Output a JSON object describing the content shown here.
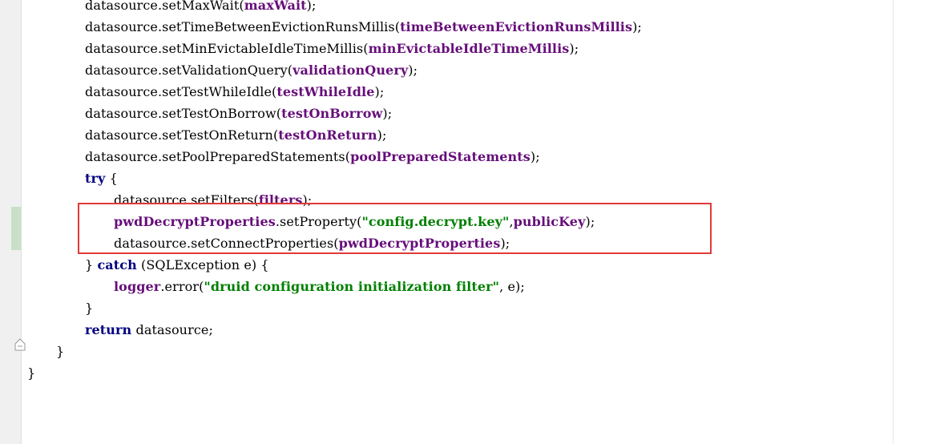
{
  "editor": {
    "lines": [
      {
        "indent": 2,
        "tokens": [
          {
            "t": "datasource",
            "c": "plain"
          },
          {
            "t": ".",
            "c": "plain"
          },
          {
            "t": "setMaxWait",
            "c": "mth"
          },
          {
            "t": "(",
            "c": "plain"
          },
          {
            "t": "maxWait",
            "c": "fld"
          },
          {
            "t": ");",
            "c": "plain"
          }
        ]
      },
      {
        "indent": 2,
        "tokens": [
          {
            "t": "datasource",
            "c": "plain"
          },
          {
            "t": ".",
            "c": "plain"
          },
          {
            "t": "setTimeBetweenEvictionRunsMillis",
            "c": "mth"
          },
          {
            "t": "(",
            "c": "plain"
          },
          {
            "t": "timeBetweenEvictionRunsMillis",
            "c": "fld"
          },
          {
            "t": ");",
            "c": "plain"
          }
        ]
      },
      {
        "indent": 2,
        "tokens": [
          {
            "t": "datasource",
            "c": "plain"
          },
          {
            "t": ".",
            "c": "plain"
          },
          {
            "t": "setMinEvictableIdleTimeMillis",
            "c": "mth"
          },
          {
            "t": "(",
            "c": "plain"
          },
          {
            "t": "minEvictableIdleTimeMillis",
            "c": "fld"
          },
          {
            "t": ");",
            "c": "plain"
          }
        ]
      },
      {
        "indent": 2,
        "tokens": [
          {
            "t": "datasource",
            "c": "plain"
          },
          {
            "t": ".",
            "c": "plain"
          },
          {
            "t": "setValidationQuery",
            "c": "mth"
          },
          {
            "t": "(",
            "c": "plain"
          },
          {
            "t": "validationQuery",
            "c": "fld"
          },
          {
            "t": ");",
            "c": "plain"
          }
        ]
      },
      {
        "indent": 2,
        "tokens": [
          {
            "t": "datasource",
            "c": "plain"
          },
          {
            "t": ".",
            "c": "plain"
          },
          {
            "t": "setTestWhileIdle",
            "c": "mth"
          },
          {
            "t": "(",
            "c": "plain"
          },
          {
            "t": "testWhileIdle",
            "c": "fld"
          },
          {
            "t": ");",
            "c": "plain"
          }
        ]
      },
      {
        "indent": 2,
        "tokens": [
          {
            "t": "datasource",
            "c": "plain"
          },
          {
            "t": ".",
            "c": "plain"
          },
          {
            "t": "setTestOnBorrow",
            "c": "mth"
          },
          {
            "t": "(",
            "c": "plain"
          },
          {
            "t": "testOnBorrow",
            "c": "fld"
          },
          {
            "t": ");",
            "c": "plain"
          }
        ]
      },
      {
        "indent": 2,
        "tokens": [
          {
            "t": "datasource",
            "c": "plain"
          },
          {
            "t": ".",
            "c": "plain"
          },
          {
            "t": "setTestOnReturn",
            "c": "mth"
          },
          {
            "t": "(",
            "c": "plain"
          },
          {
            "t": "testOnReturn",
            "c": "fld"
          },
          {
            "t": ");",
            "c": "plain"
          }
        ]
      },
      {
        "indent": 2,
        "tokens": [
          {
            "t": "datasource",
            "c": "plain"
          },
          {
            "t": ".",
            "c": "plain"
          },
          {
            "t": "setPoolPreparedStatements",
            "c": "mth"
          },
          {
            "t": "(",
            "c": "plain"
          },
          {
            "t": "poolPreparedStatements",
            "c": "fld"
          },
          {
            "t": ");",
            "c": "plain"
          }
        ]
      },
      {
        "indent": 2,
        "tokens": [
          {
            "t": "try",
            "c": "kw"
          },
          {
            "t": " {",
            "c": "plain"
          }
        ]
      },
      {
        "indent": 3,
        "tokens": [
          {
            "t": "datasource",
            "c": "plain"
          },
          {
            "t": ".",
            "c": "plain"
          },
          {
            "t": "setFilters",
            "c": "mth"
          },
          {
            "t": "(",
            "c": "plain"
          },
          {
            "t": "filters",
            "c": "fld"
          },
          {
            "t": ");",
            "c": "plain"
          }
        ]
      },
      {
        "indent": 3,
        "tokens": [
          {
            "t": "pwdDecryptProperties",
            "c": "fld"
          },
          {
            "t": ".",
            "c": "plain"
          },
          {
            "t": "setProperty",
            "c": "mth"
          },
          {
            "t": "(",
            "c": "plain"
          },
          {
            "t": "\"config.decrypt.key\"",
            "c": "str"
          },
          {
            "t": ",",
            "c": "plain"
          },
          {
            "t": "publicKey",
            "c": "fld"
          },
          {
            "t": ");",
            "c": "plain"
          }
        ]
      },
      {
        "indent": 3,
        "tokens": [
          {
            "t": "datasource",
            "c": "plain"
          },
          {
            "t": ".",
            "c": "plain"
          },
          {
            "t": "setConnectProperties",
            "c": "mth"
          },
          {
            "t": "(",
            "c": "plain"
          },
          {
            "t": "pwdDecryptProperties",
            "c": "fld"
          },
          {
            "t": ");",
            "c": "plain"
          }
        ]
      },
      {
        "indent": 2,
        "tokens": [
          {
            "t": "} ",
            "c": "plain"
          },
          {
            "t": "catch",
            "c": "kw"
          },
          {
            "t": " (SQLException e) {",
            "c": "plain"
          }
        ]
      },
      {
        "indent": 3,
        "tokens": [
          {
            "t": "logger",
            "c": "fld"
          },
          {
            "t": ".",
            "c": "plain"
          },
          {
            "t": "error",
            "c": "mth"
          },
          {
            "t": "(",
            "c": "plain"
          },
          {
            "t": "\"druid configuration initialization filter\"",
            "c": "str"
          },
          {
            "t": ", e);",
            "c": "plain"
          }
        ]
      },
      {
        "indent": 2,
        "tokens": [
          {
            "t": "}",
            "c": "plain"
          }
        ]
      },
      {
        "indent": 2,
        "tokens": [
          {
            "t": "return",
            "c": "kw"
          },
          {
            "t": " datasource;",
            "c": "plain"
          }
        ]
      },
      {
        "indent": 1,
        "tokens": [
          {
            "t": "}",
            "c": "plain"
          }
        ]
      },
      {
        "indent": 0,
        "tokens": [
          {
            "t": "}",
            "c": "plain"
          }
        ]
      }
    ]
  },
  "colors": {
    "keyword": "#000080",
    "field": "#660e7a",
    "string": "#008000",
    "highlight_border": "#e03a3a",
    "gutter": "#f0f0f0",
    "change_marker": "#c8e0c8"
  }
}
